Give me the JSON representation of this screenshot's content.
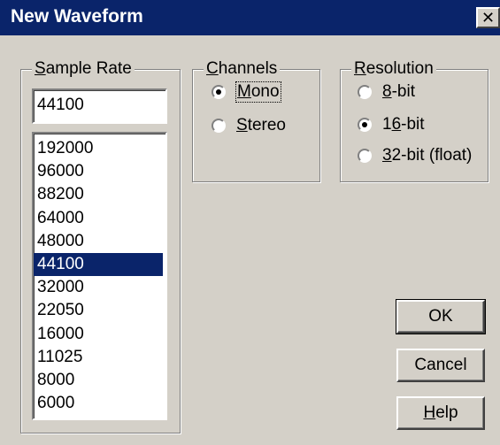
{
  "window": {
    "title": "New Waveform",
    "close_glyph": "✕"
  },
  "sample_rate": {
    "legend_accel": "S",
    "legend_rest": "ample Rate",
    "current_value": "44100",
    "options": [
      "192000",
      "96000",
      "88200",
      "64000",
      "48000",
      "44100",
      "32000",
      "22050",
      "16000",
      "11025",
      "8000",
      "6000"
    ],
    "selected": "44100"
  },
  "channels": {
    "legend_accel": "C",
    "legend_rest": "hannels",
    "options": [
      {
        "accel": "M",
        "rest": "ono",
        "checked": true
      },
      {
        "accel": "S",
        "rest": "tereo",
        "checked": false
      }
    ]
  },
  "resolution": {
    "legend_accel": "R",
    "legend_rest": "esolution",
    "options": [
      {
        "pre": "",
        "accel": "8",
        "rest": "-bit",
        "checked": false
      },
      {
        "pre": "1",
        "accel": "6",
        "rest": "-bit",
        "checked": true
      },
      {
        "pre": "",
        "accel": "3",
        "rest": "2-bit (float)",
        "checked": false
      }
    ]
  },
  "buttons": {
    "ok": "OK",
    "cancel": "Cancel",
    "help_accel": "H",
    "help_rest": "elp"
  },
  "colors": {
    "titlebar": "#0a246a",
    "face": "#d4d0c8",
    "selection": "#0a246a"
  }
}
